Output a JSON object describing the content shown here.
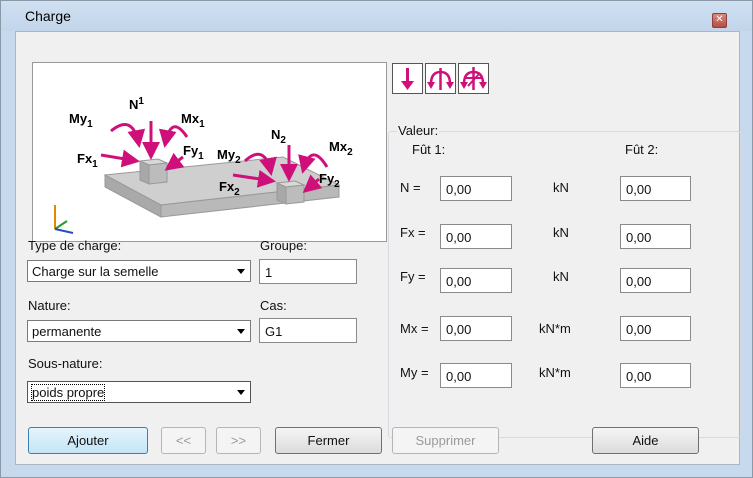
{
  "window": {
    "title": "Charge",
    "close_symbol": "✕"
  },
  "illustration": {
    "labels": {
      "n1": "N",
      "n1_sub": "1",
      "my1": "My",
      "my1_sub": "1",
      "mx1": "Mx",
      "mx1_sub": "1",
      "fx1": "Fx",
      "fx1_sub": "1",
      "fy1": "Fy",
      "fy1_sub": "1",
      "n2": "N",
      "n2_sub": "2",
      "my2": "My",
      "my2_sub": "2",
      "mx2": "Mx",
      "mx2_sub": "2",
      "fx2": "Fx",
      "fx2_sub": "2",
      "fy2": "Fy",
      "fy2_sub": "2"
    },
    "accent_color": "#d0107a"
  },
  "left": {
    "type_label": "Type de charge:",
    "type_value": "Charge sur la semelle",
    "group_label": "Groupe:",
    "group_value": "1",
    "nature_label": "Nature:",
    "nature_value": "permanente",
    "cas_label": "Cas:",
    "cas_value": "G1",
    "subnature_label": "Sous-nature:",
    "subnature_value": "poids propre"
  },
  "icon_buttons": [
    {
      "name": "force-down-icon"
    },
    {
      "name": "moment-rotate-icon"
    },
    {
      "name": "combined-load-icon"
    }
  ],
  "values": {
    "group_label": "Valeur:",
    "col1_header": "Fût 1:",
    "col2_header": "Fût 2:",
    "rows": [
      {
        "label": "N =",
        "unit": "kN",
        "v1": "0,00",
        "v2": "0,00"
      },
      {
        "label": "Fx =",
        "unit": "kN",
        "v1": "0,00",
        "v2": "0,00"
      },
      {
        "label": "Fy =",
        "unit": "kN",
        "v1": "0,00",
        "v2": "0,00"
      },
      {
        "label": "Mx =",
        "unit": "kN*m",
        "v1": "0,00",
        "v2": "0,00"
      },
      {
        "label": "My =",
        "unit": "kN*m",
        "v1": "0,00",
        "v2": "0,00"
      }
    ]
  },
  "buttons": {
    "add": "Ajouter",
    "prev": "<<",
    "next": ">>",
    "close": "Fermer",
    "delete": "Supprimer",
    "help": "Aide"
  }
}
